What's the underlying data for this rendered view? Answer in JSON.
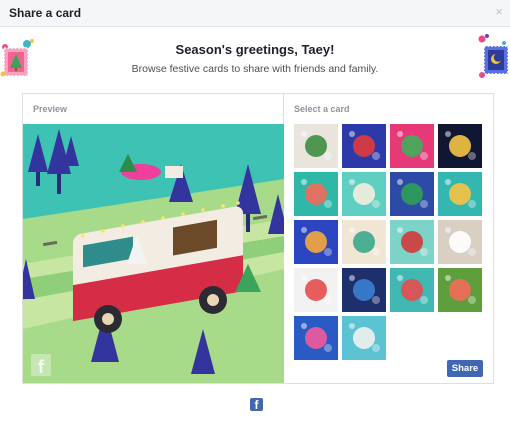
{
  "dialog": {
    "title": "Share a card",
    "close_label": "×"
  },
  "header": {
    "greeting": "Season's greetings, Taey!",
    "subtitle": "Browse festive cards to share with friends and family."
  },
  "preview": {
    "label": "Preview",
    "image": "paper-craft-camper-van-with-christmas-tree",
    "watermark_letter": "f"
  },
  "select": {
    "label": "Select a card",
    "thumbnails": [
      {
        "name": "card-gnome",
        "bg": "#e9e4dc",
        "accent": "#3d8c40"
      },
      {
        "name": "card-gifts",
        "bg": "#2b3aa8",
        "accent": "#e23b3b"
      },
      {
        "name": "card-cactus",
        "bg": "#e73978",
        "accent": "#3fae5a"
      },
      {
        "name": "card-fireworks",
        "bg": "#111633",
        "accent": "#f4c542"
      },
      {
        "name": "card-ornaments",
        "bg": "#2fb7a8",
        "accent": "#f26b5b"
      },
      {
        "name": "card-latte",
        "bg": "#5fcfc2",
        "accent": "#f4ecde"
      },
      {
        "name": "card-tree",
        "bg": "#2c4aa6",
        "accent": "#2f9e58"
      },
      {
        "name": "card-menorah",
        "bg": "#34b7b0",
        "accent": "#f6c343"
      },
      {
        "name": "card-night",
        "bg": "#2b45c0",
        "accent": "#f4a93b"
      },
      {
        "name": "card-knot",
        "bg": "#efe6d3",
        "accent": "#3aa98c"
      },
      {
        "name": "card-van",
        "bg": "#7ed3c8",
        "accent": "#d23a3a"
      },
      {
        "name": "card-birds",
        "bg": "#d9cfc3",
        "accent": "#ffffff"
      },
      {
        "name": "card-santa",
        "bg": "#f2f2f2",
        "accent": "#e64b4b"
      },
      {
        "name": "card-forest",
        "bg": "#1e2f6e",
        "accent": "#3a7fd0"
      },
      {
        "name": "card-snowglobe",
        "bg": "#41b8b2",
        "accent": "#e54c4c"
      },
      {
        "name": "card-parrot",
        "bg": "#5e9e3c",
        "accent": "#f26a5a"
      },
      {
        "name": "card-origami",
        "bg": "#2a5bc4",
        "accent": "#f25a9a"
      },
      {
        "name": "card-pine",
        "bg": "#5cc3d2",
        "accent": "#f1f1f1"
      }
    ]
  },
  "actions": {
    "share_label": "Share"
  },
  "footer": {
    "logo_letter": "f"
  },
  "colors": {
    "brand": "#4267b2",
    "border": "#dddfe2",
    "muted": "#90949c"
  }
}
